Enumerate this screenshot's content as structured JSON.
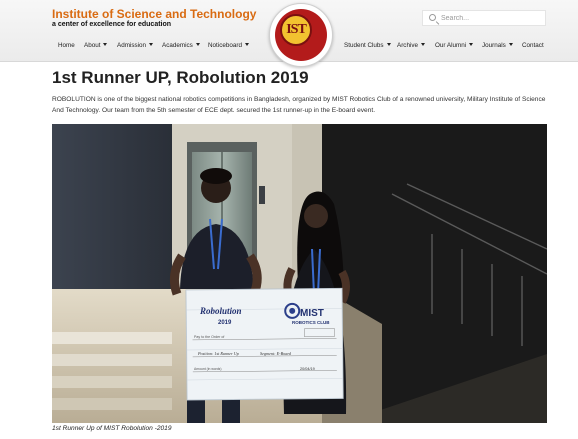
{
  "header": {
    "site_name": "Institute of Science and Technology",
    "tagline": "a center of excellence for education",
    "logo_text": "IST",
    "search_placeholder": "Search...",
    "nav_left": [
      {
        "label": "Home",
        "dropdown": false
      },
      {
        "label": "About",
        "dropdown": true
      },
      {
        "label": "Admission",
        "dropdown": true
      },
      {
        "label": "Academics",
        "dropdown": true
      },
      {
        "label": "Noticeboard",
        "dropdown": true
      }
    ],
    "nav_right": [
      {
        "label": "Student Clubs",
        "dropdown": true
      },
      {
        "label": "Archive",
        "dropdown": true
      },
      {
        "label": "Our Alumni",
        "dropdown": true
      },
      {
        "label": "Journals",
        "dropdown": true
      },
      {
        "label": "Contact",
        "dropdown": false
      }
    ]
  },
  "article": {
    "title": "1st Runner UP, Robolution 2019",
    "description": "ROBOLUTION is one of the biggest national robotics competitions in Bangladesh, organized by MIST Robotics Club of a renowned university, Military Institute of Science And Technology. Our team from the 5th semester of ECE dept. secured the 1st runner-up in the E-board event.",
    "caption": "1st Runner Up of MIST Robolution -2019"
  },
  "cheque": {
    "left_brand": "Robolution",
    "left_year": "2019",
    "right_brand": "MIST",
    "right_sub": "ROBOTICS CLUB",
    "pay_line": "Pay to the Order of",
    "position_line": "Position: 1st Runner Up",
    "segment_line": "Segment: E-Board",
    "amount_line": "Amount (in words)",
    "date_value": "20/04/19"
  },
  "colors": {
    "brand_orange": "#d96b12",
    "logo_red": "#b31b1b",
    "logo_gold": "#f2c230"
  }
}
